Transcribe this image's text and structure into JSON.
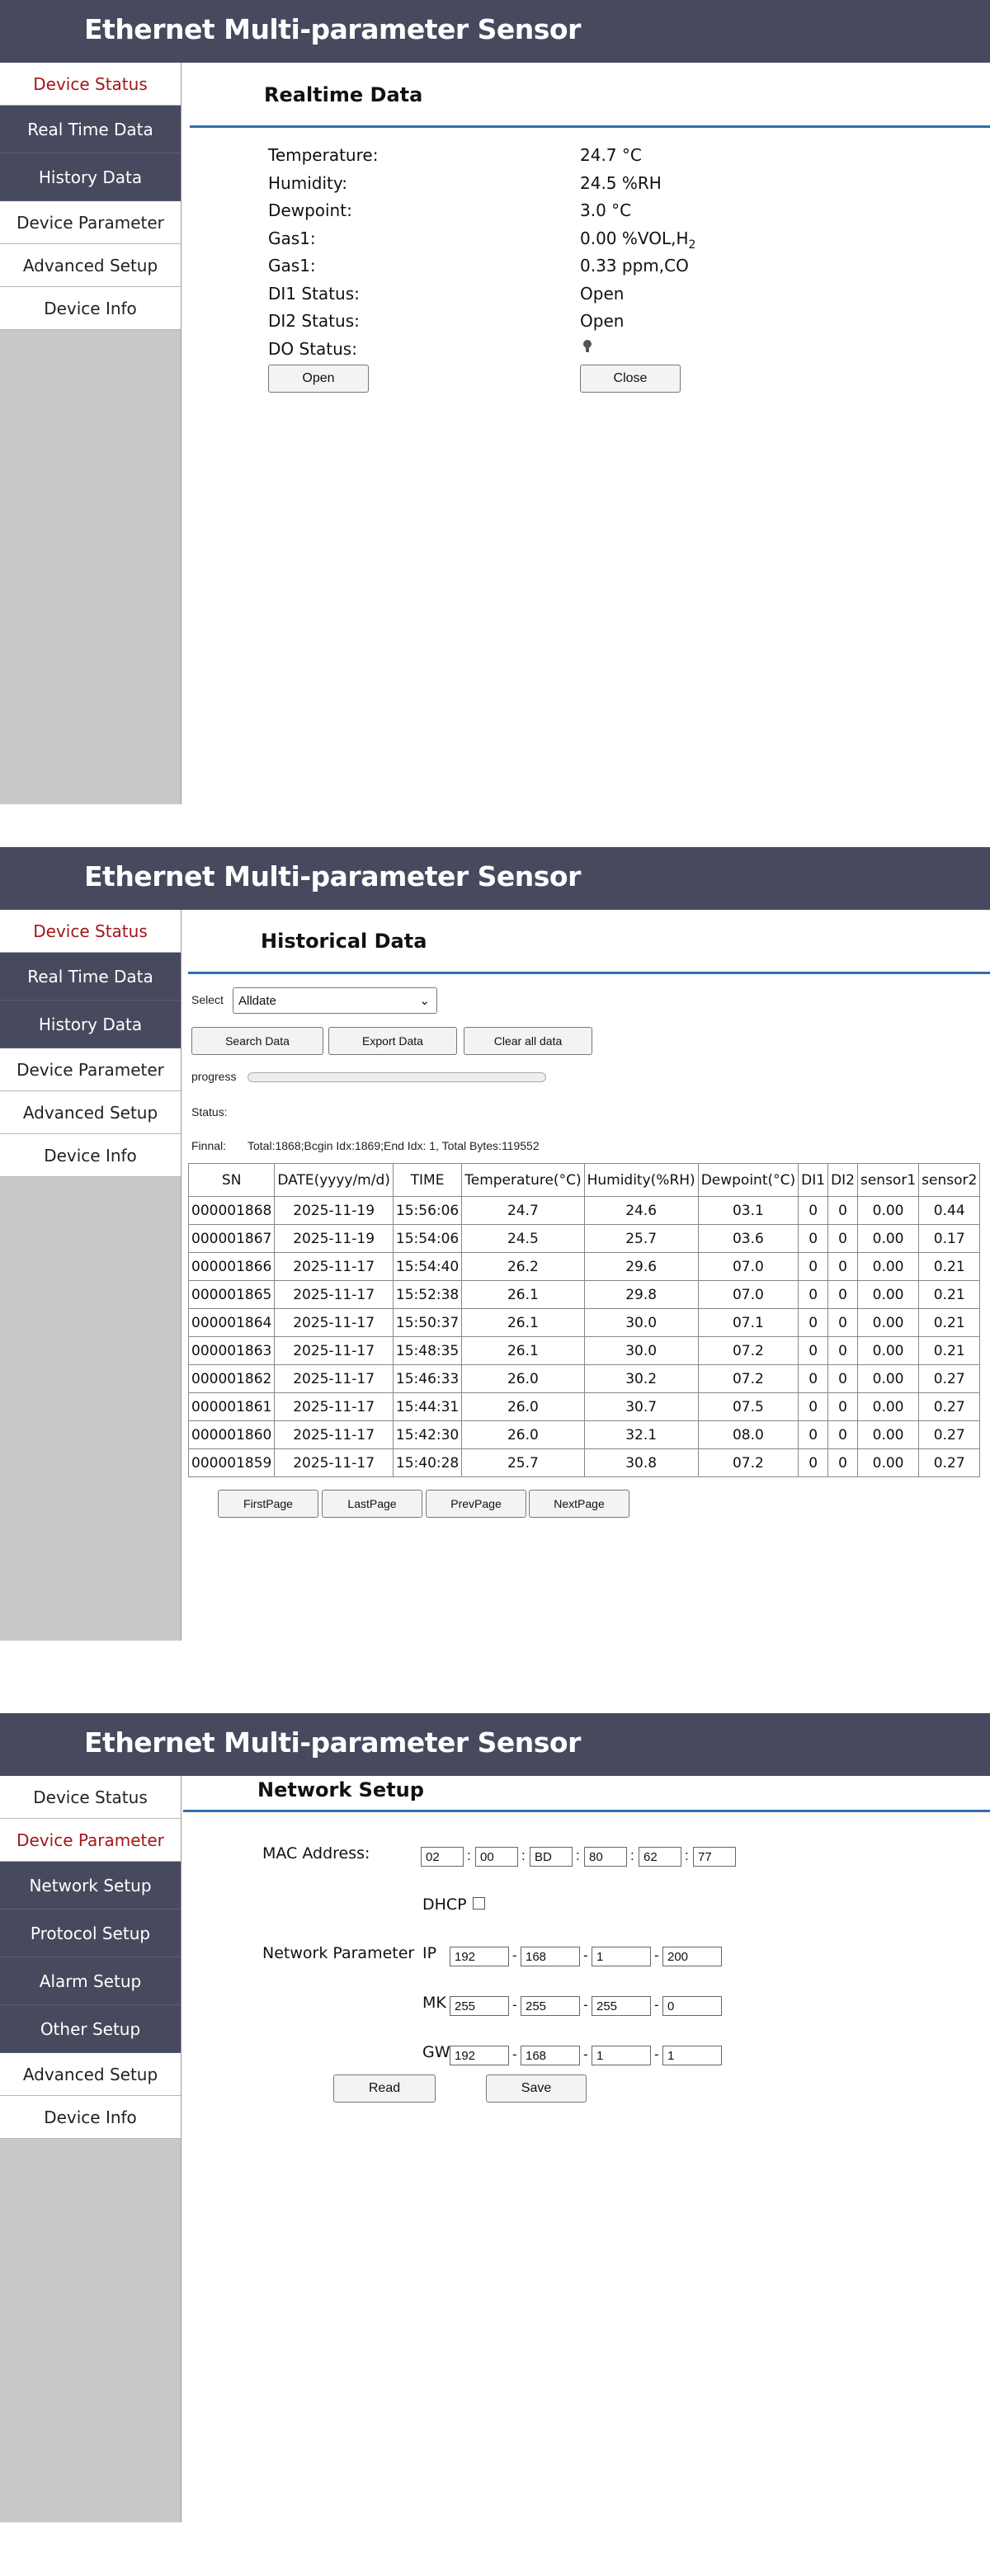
{
  "app_title": "Ethernet Multi-parameter Sensor",
  "nav": {
    "device_status": "Device Status",
    "real_time_data": "Real Time Data",
    "history_data": "History Data",
    "device_parameter": "Device Parameter",
    "advanced_setup": "Advanced Setup",
    "device_info": "Device Info",
    "network_setup": "Network Setup",
    "protocol_setup": "Protocol Setup",
    "alarm_setup": "Alarm Setup",
    "other_setup": "Other Setup"
  },
  "realtime": {
    "title": "Realtime Data",
    "rows": [
      {
        "label": "Temperature:",
        "value": "24.7 °C"
      },
      {
        "label": "Humidity:",
        "value": "24.5 %RH"
      },
      {
        "label": "Dewpoint:",
        "value": "3.0 °C"
      },
      {
        "label": "Gas1:",
        "value": "0.00 %VOL,H",
        "sub": "2"
      },
      {
        "label": "Gas1:",
        "value": "0.33 ppm,CO"
      },
      {
        "label": "DI1 Status:",
        "value": "Open"
      },
      {
        "label": "DI2 Status:",
        "value": "Open"
      },
      {
        "label": "DO Status:",
        "value": ""
      }
    ],
    "open_button": "Open",
    "close_button": "Close"
  },
  "history": {
    "title": "Historical Data",
    "select_label": "Select",
    "select_value": "Alldate",
    "search_button": "Search Data",
    "export_button": "Export Data",
    "clear_button": "Clear all data",
    "progress_label": "progress",
    "progress_value": 0,
    "status_label": "Status:",
    "final_label": "Finnal:",
    "final_text": "Total:1868;Bcgin Idx:1869;End Idx: 1, Total Bytes:119552",
    "columns": [
      "SN",
      "DATE(yyyy/m/d)",
      "TIME",
      "Temperature(°C)",
      "Humidity(%RH)",
      "Dewpoint(°C)",
      "DI1",
      "DI2",
      "sensor1",
      "sensor2"
    ],
    "rows": [
      [
        "000001868",
        "2025-11-19",
        "15:56:06",
        "24.7",
        "24.6",
        "03.1",
        "0",
        "0",
        "0.00",
        "0.44"
      ],
      [
        "000001867",
        "2025-11-19",
        "15:54:06",
        "24.5",
        "25.7",
        "03.6",
        "0",
        "0",
        "0.00",
        "0.17"
      ],
      [
        "000001866",
        "2025-11-17",
        "15:54:40",
        "26.2",
        "29.6",
        "07.0",
        "0",
        "0",
        "0.00",
        "0.21"
      ],
      [
        "000001865",
        "2025-11-17",
        "15:52:38",
        "26.1",
        "29.8",
        "07.0",
        "0",
        "0",
        "0.00",
        "0.21"
      ],
      [
        "000001864",
        "2025-11-17",
        "15:50:37",
        "26.1",
        "30.0",
        "07.1",
        "0",
        "0",
        "0.00",
        "0.21"
      ],
      [
        "000001863",
        "2025-11-17",
        "15:48:35",
        "26.1",
        "30.0",
        "07.2",
        "0",
        "0",
        "0.00",
        "0.21"
      ],
      [
        "000001862",
        "2025-11-17",
        "15:46:33",
        "26.0",
        "30.2",
        "07.2",
        "0",
        "0",
        "0.00",
        "0.27"
      ],
      [
        "000001861",
        "2025-11-17",
        "15:44:31",
        "26.0",
        "30.7",
        "07.5",
        "0",
        "0",
        "0.00",
        "0.27"
      ],
      [
        "000001860",
        "2025-11-17",
        "15:42:30",
        "26.0",
        "32.1",
        "08.0",
        "0",
        "0",
        "0.00",
        "0.27"
      ],
      [
        "000001859",
        "2025-11-17",
        "15:40:28",
        "25.7",
        "30.8",
        "07.2",
        "0",
        "0",
        "0.00",
        "0.27"
      ]
    ],
    "first_page": "FirstPage",
    "last_page": "LastPage",
    "prev_page": "PrevPage",
    "next_page": "NextPage"
  },
  "network": {
    "title": "Network Setup",
    "mac_label": "MAC Address:",
    "mac": [
      "02",
      "00",
      "BD",
      "80",
      "62",
      "77"
    ],
    "dhcp_label": "DHCP",
    "dhcp_checked": false,
    "net_param_label": "Network Parameter",
    "ip_label": "IP",
    "ip": [
      "192",
      "168",
      "1",
      "200"
    ],
    "mk_label": "MK",
    "mk": [
      "255",
      "255",
      "255",
      "0"
    ],
    "gw_label": "GW",
    "gw": [
      "192",
      "168",
      "1",
      "1"
    ],
    "read_button": "Read",
    "save_button": "Save"
  },
  "colors": {
    "header_bg": "#474a5e",
    "active_nav": "#a4161a",
    "rule_blue": "#2e6fb0",
    "sidebar_gray": "#c8c8c8"
  }
}
